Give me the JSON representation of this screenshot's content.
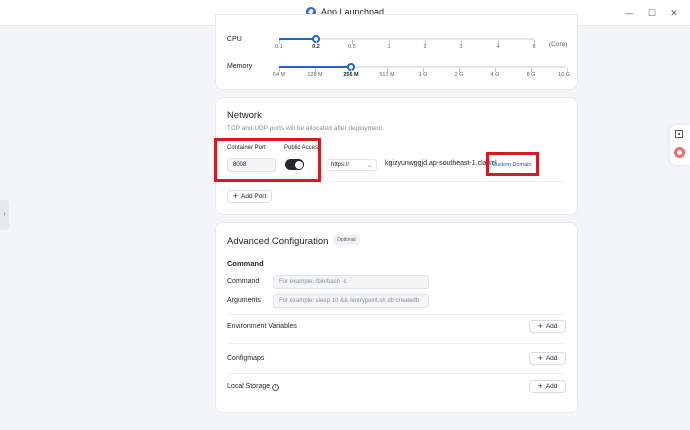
{
  "window": {
    "title": "App Launchpad",
    "minimize": "—",
    "maximize": "☐",
    "close": "✕"
  },
  "side": {
    "left_handle": "›"
  },
  "resources": {
    "cpu": {
      "label": "CPU",
      "ticks": [
        "0.1",
        "0.2",
        "0.5",
        "1",
        "2",
        "3",
        "4",
        "8"
      ],
      "selected": "0.2",
      "unit": "(Core)"
    },
    "memory": {
      "label": "Memory",
      "ticks": [
        "64 M",
        "128 M",
        "256 M",
        "512 M",
        "1 G",
        "2 G",
        "4 G",
        "8 G",
        "16 G"
      ],
      "selected": "256 M"
    }
  },
  "network": {
    "title": "Network",
    "description": "TCP and UDP ports will be allocated after deployment.",
    "port_label": "Container Port",
    "port_value": "8008",
    "public_access_label": "Public Access",
    "public_access_on": true,
    "protocol": "https://",
    "domain": "kgizyunwggjd.ap-southeast-1.clawcl",
    "custom_domain": "Custom Domain",
    "add_port": "Add Port"
  },
  "advanced": {
    "title": "Advanced Configuration",
    "badge": "Optional",
    "command_section": "Command",
    "command_label": "Command",
    "command_placeholder": "For example: /bin/bash -c",
    "arguments_label": "Arguments",
    "arguments_placeholder": "For example: sleep 10 && /entrypoint.sh db createdb",
    "env_label": "Environment Variables",
    "configmaps_label": "Configmaps",
    "storage_label": "Local Storage",
    "add_label": "Add"
  },
  "colors": {
    "accent": "#2163d3",
    "annotation": "#d71920"
  }
}
